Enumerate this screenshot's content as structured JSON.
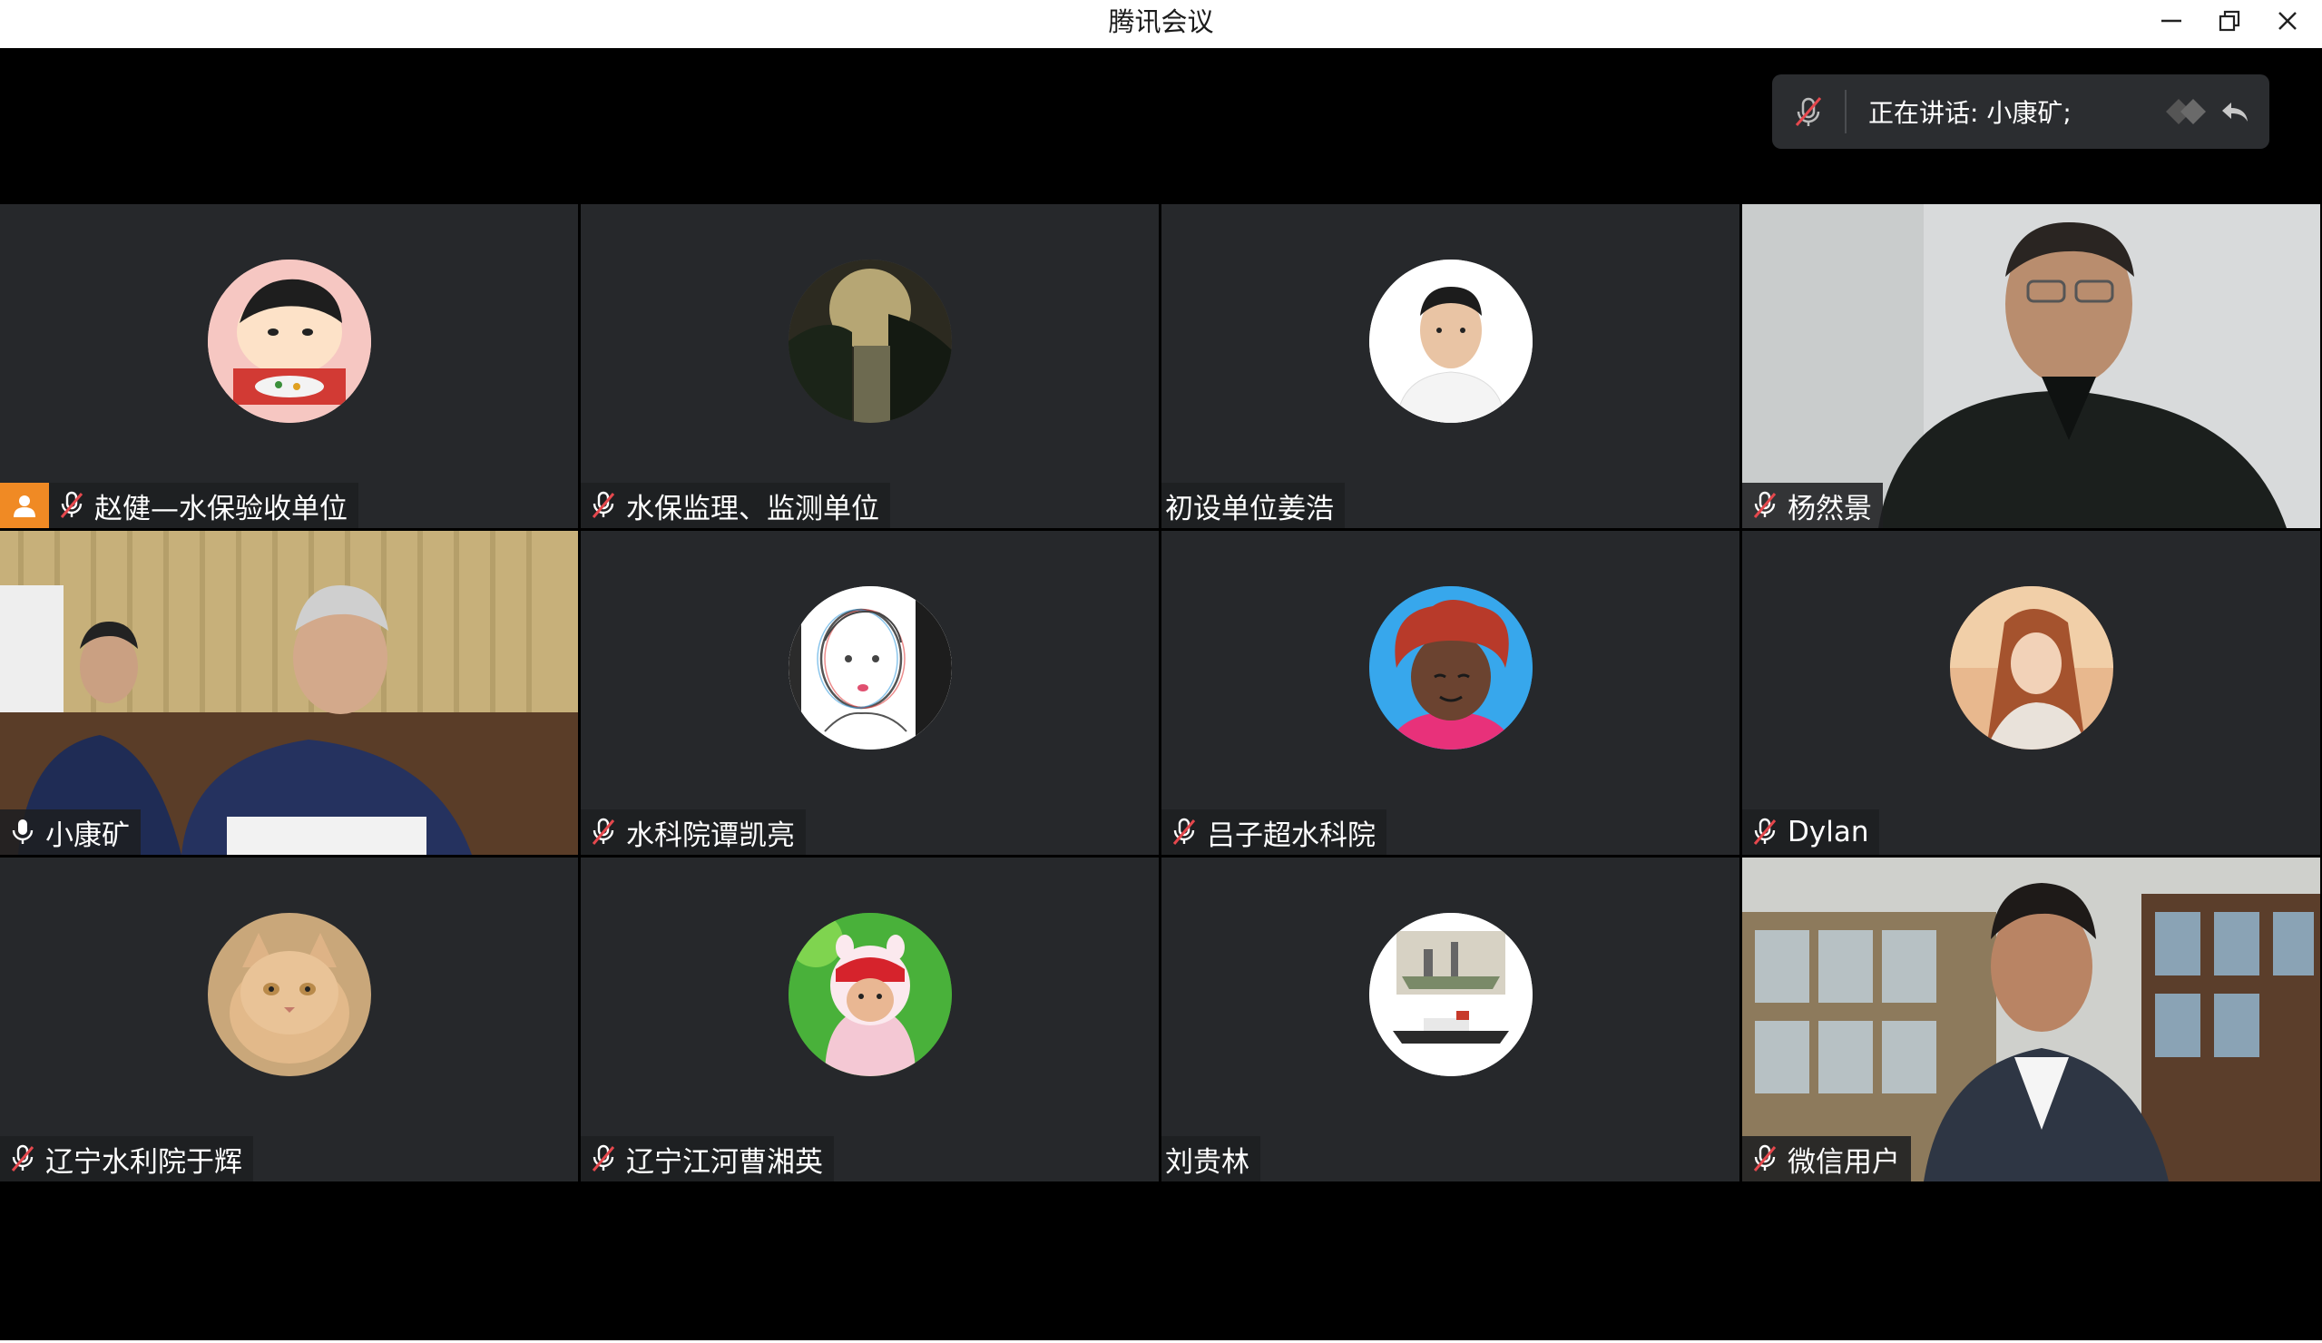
{
  "window": {
    "title": "腾讯会议",
    "controls": {
      "minimize": "minimize-icon",
      "restore": "restore-icon",
      "close": "close-icon"
    }
  },
  "speaking": {
    "label": "正在讲话: 小康矿;",
    "mic_icon": "mic-muted-icon"
  },
  "participants": [
    {
      "name": "赵健—水保验收单位",
      "muted": true,
      "host": true,
      "type": "avatar",
      "avatar_icon": "cartoon-boy-avatar"
    },
    {
      "name": "水保监理、监测单位",
      "muted": true,
      "type": "avatar",
      "avatar_icon": "landscape-avatar"
    },
    {
      "name": "初设单位姜浩",
      "muted": false,
      "type": "avatar",
      "avatar_icon": "portrait-avatar"
    },
    {
      "name": "杨然景",
      "muted": true,
      "type": "video"
    },
    {
      "name": "小康矿",
      "muted": false,
      "speaking": true,
      "type": "video"
    },
    {
      "name": "水科院谭凯亮",
      "muted": true,
      "type": "avatar",
      "avatar_icon": "sketch-avatar"
    },
    {
      "name": "吕子超水科院",
      "muted": true,
      "type": "avatar",
      "avatar_icon": "cartoon-redhair-avatar"
    },
    {
      "name": "Dylan",
      "muted": true,
      "type": "avatar",
      "avatar_icon": "girl-photo-avatar"
    },
    {
      "name": "辽宁水利院于辉",
      "muted": true,
      "type": "avatar",
      "avatar_icon": "cat-avatar"
    },
    {
      "name": "辽宁江河曹湘英",
      "muted": true,
      "type": "avatar",
      "avatar_icon": "baby-avatar"
    },
    {
      "name": "刘贵林",
      "muted": false,
      "type": "avatar",
      "avatar_icon": "ship-model-avatar"
    },
    {
      "name": "微信用户",
      "muted": true,
      "type": "video"
    }
  ],
  "colors": {
    "tile_bg": "#26282b",
    "host_badge": "#f08a24",
    "active_border": "#33a852",
    "mute_red": "#e5484d"
  }
}
